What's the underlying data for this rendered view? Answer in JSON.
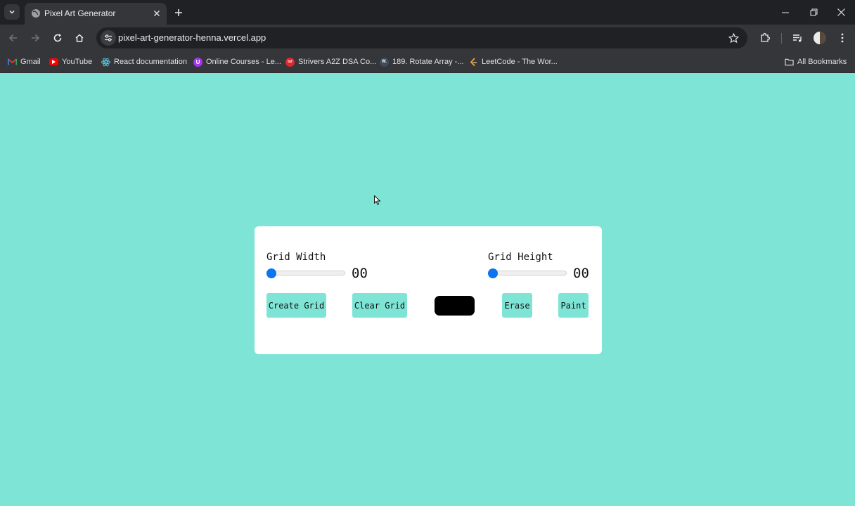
{
  "browser": {
    "tab": {
      "title": "Pixel Art Generator"
    },
    "url": "pixel-art-generator-henna.vercel.app",
    "bookmarks": [
      {
        "label": "Gmail",
        "icon": "gmail-icon",
        "color": "#ea4335"
      },
      {
        "label": "YouTube",
        "icon": "youtube-icon",
        "color": "#ff0000"
      },
      {
        "label": "React documentation",
        "icon": "react-icon",
        "color": "#58c4dc"
      },
      {
        "label": "Online Courses - Le...",
        "icon": "udemy-icon",
        "color": "#a435f0"
      },
      {
        "label": "Strivers A2Z DSA Co...",
        "icon": "tuf-icon",
        "color": "#e0272e"
      },
      {
        "label": "189. Rotate Array -...",
        "icon": "leetcode-wc-icon",
        "color": "#3d4b5c"
      },
      {
        "label": "LeetCode - The Wor...",
        "icon": "leetcode-icon",
        "color": "#ffa116"
      }
    ],
    "all_bookmarks_label": "All Bookmarks"
  },
  "app": {
    "background_color": "#7ee5d6",
    "grid_width": {
      "label": "Grid Width",
      "value": "00",
      "slider_position": 0
    },
    "grid_height": {
      "label": "Grid Height",
      "value": "00",
      "slider_position": 0
    },
    "buttons": {
      "create_grid": "Create Grid",
      "clear_grid": "Clear Grid",
      "erase": "Erase",
      "paint": "Paint"
    },
    "selected_color": "#000000",
    "accent_color": "#0b74ee"
  }
}
